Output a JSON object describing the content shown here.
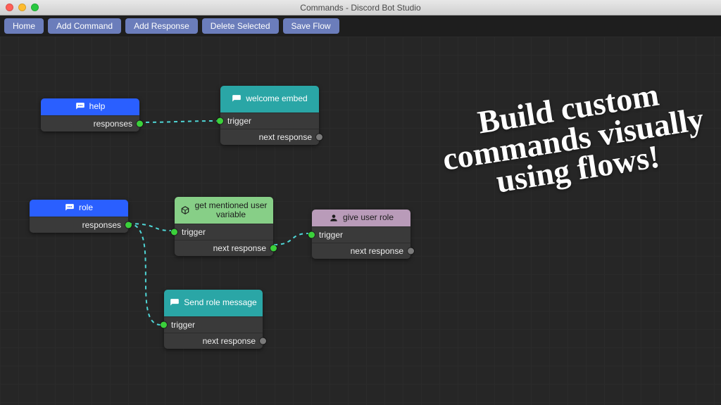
{
  "window": {
    "title": "Commands - Discord Bot Studio"
  },
  "toolbar": {
    "home": "Home",
    "add_command": "Add Command",
    "add_response": "Add Response",
    "delete_selected": "Delete Selected",
    "save_flow": "Save Flow"
  },
  "overlay": "Build custom commands visually using flows!",
  "labels": {
    "responses": "responses",
    "trigger": "trigger",
    "next_response": "next response"
  },
  "nodes": {
    "help": {
      "title": "help"
    },
    "welcome": {
      "title": "welcome embed"
    },
    "role": {
      "title": "role"
    },
    "var": {
      "title": "get mentioned user variable"
    },
    "give": {
      "title": "give user role"
    },
    "send": {
      "title": "Send role message"
    }
  }
}
